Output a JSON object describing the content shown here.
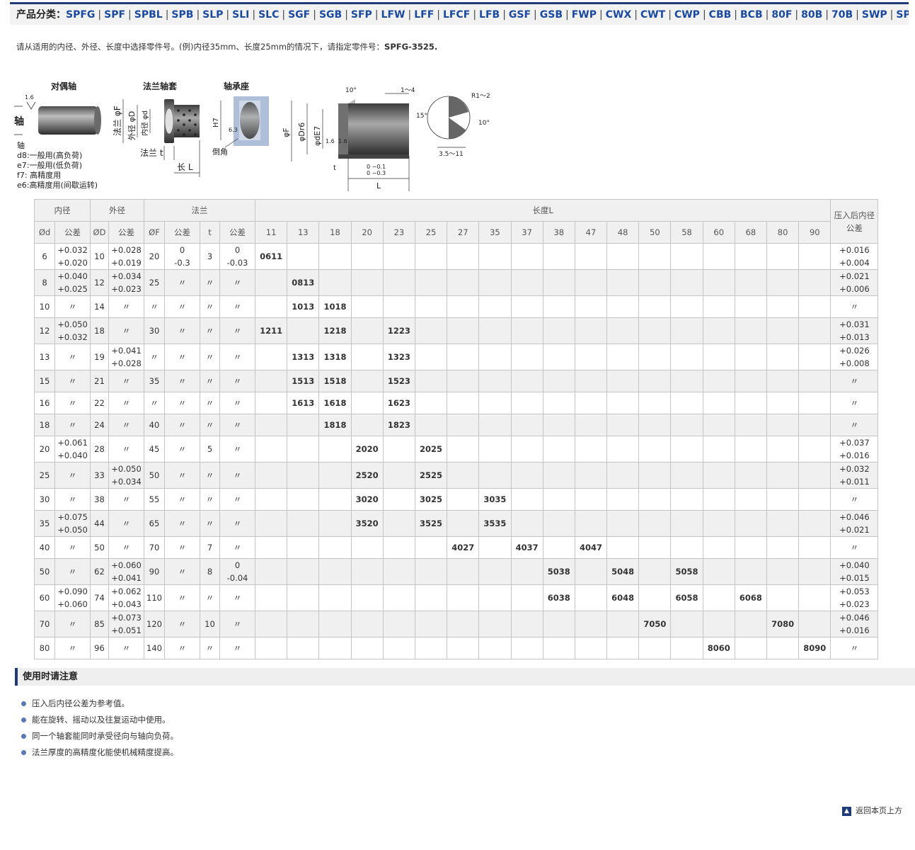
{
  "category_bar": {
    "label": "产品分类：",
    "items": [
      "SPFG",
      "SPF",
      "SPBL",
      "SPB",
      "SLP",
      "SLI",
      "SLC",
      "SGF",
      "SGB",
      "SFP",
      "LFW",
      "LFF",
      "LFCF",
      "LFB",
      "GSF",
      "GSB",
      "FWP",
      "CWX",
      "CWT",
      "CWP",
      "CBB",
      "BCB",
      "80F",
      "80B",
      "70B",
      "SWP",
      "SPW"
    ]
  },
  "intro": {
    "text": "请从适用的内径、外径、长度中选择零件号。(例)内径35mm、长度25mm的情况下，请指定零件号：",
    "example_pn": "SPFG-3525."
  },
  "diagram": {
    "labels": {
      "shaft_title": "对偶轴",
      "flange_bush_title": "法兰轴套",
      "housing_title": "轴承座",
      "roughness": "1.6",
      "shaft_word": "轴",
      "flange_dia": "法兰 φF",
      "outer_dia": "外径 φD",
      "inner_dia": "内径 φd",
      "flange_t": "法兰 t",
      "length_l": "长 L",
      "h7": "H7",
      "roughness_h": "6.3",
      "chamfer": "倒角",
      "angle_10": "10°",
      "range_1_4": "1～4",
      "angle_15": "15°",
      "phi_f": "φF",
      "phi_dr6": "φDr6",
      "phi_de7": "φdE7",
      "rough_a": "1.6",
      "rough_b": "1.6",
      "t_label": "t",
      "l_tol": "0 −0.1",
      "l_tol2": "0 −0.3",
      "l_label": "L",
      "r_label": "R1～2",
      "angle_10b": "10°",
      "range_35_11": "3.5～11"
    },
    "shaft_notes": [
      "轴",
      "d8:一般用(高负荷)",
      "e7:一般用(低负荷)",
      "f7: 高精度用",
      "e6:高精度用(间歇运转)"
    ]
  },
  "table": {
    "group_headers": {
      "inner": "内径",
      "outer": "外径",
      "flange": "法兰",
      "length": "长度L",
      "press": "压入后内径公差"
    },
    "sub_headers": {
      "d": "Ød",
      "tol1": "公差",
      "D": "ØD",
      "tol2": "公差",
      "F": "ØF",
      "tol3": "公差",
      "t": "t",
      "tol4": "公差"
    },
    "lengths": [
      "11",
      "13",
      "18",
      "20",
      "23",
      "25",
      "27",
      "35",
      "37",
      "38",
      "47",
      "48",
      "50",
      "58",
      "60",
      "68",
      "80",
      "90"
    ],
    "rows": [
      {
        "d": "6",
        "dt": [
          "+0.032",
          "+0.020"
        ],
        "D": "10",
        "Dt": [
          "+0.028",
          "+0.019"
        ],
        "F": "20",
        "Ft": [
          "0",
          "-0.3"
        ],
        "t": "3",
        "tt": [
          "0",
          "-0.03"
        ],
        "cells": {
          "11": "0611"
        },
        "pt": [
          "+0.016",
          "+0.004"
        ]
      },
      {
        "d": "8",
        "dt": [
          "+0.040",
          "+0.025"
        ],
        "D": "12",
        "Dt": [
          "+0.034",
          "+0.023"
        ],
        "F": "25",
        "Ft": [
          "〃"
        ],
        "t": "〃",
        "tt": [
          "〃"
        ],
        "cells": {
          "13": "0813"
        },
        "pt": [
          "+0.021",
          "+0.006"
        ]
      },
      {
        "d": "10",
        "dt": [
          "〃"
        ],
        "D": "14",
        "Dt": [
          "〃"
        ],
        "F": "〃",
        "Ft": [
          "〃"
        ],
        "t": "〃",
        "tt": [
          "〃"
        ],
        "cells": {
          "13": "1013",
          "18": "1018"
        },
        "pt": [
          "〃"
        ]
      },
      {
        "d": "12",
        "dt": [
          "+0.050",
          "+0.032"
        ],
        "D": "18",
        "Dt": [
          "〃"
        ],
        "F": "30",
        "Ft": [
          "〃"
        ],
        "t": "〃",
        "tt": [
          "〃"
        ],
        "cells": {
          "11": "1211",
          "18": "1218",
          "23": "1223"
        },
        "pt": [
          "+0.031",
          "+0.013"
        ]
      },
      {
        "d": "13",
        "dt": [
          "〃"
        ],
        "D": "19",
        "Dt": [
          "+0.041",
          "+0.028"
        ],
        "F": "〃",
        "Ft": [
          "〃"
        ],
        "t": "〃",
        "tt": [
          "〃"
        ],
        "cells": {
          "13": "1313",
          "18": "1318",
          "23": "1323"
        },
        "pt": [
          "+0.026",
          "+0.008"
        ]
      },
      {
        "d": "15",
        "dt": [
          "〃"
        ],
        "D": "21",
        "Dt": [
          "〃"
        ],
        "F": "35",
        "Ft": [
          "〃"
        ],
        "t": "〃",
        "tt": [
          "〃"
        ],
        "cells": {
          "13": "1513",
          "18": "1518",
          "23": "1523"
        },
        "pt": [
          "〃"
        ]
      },
      {
        "d": "16",
        "dt": [
          "〃"
        ],
        "D": "22",
        "Dt": [
          "〃"
        ],
        "F": "〃",
        "Ft": [
          "〃"
        ],
        "t": "〃",
        "tt": [
          "〃"
        ],
        "cells": {
          "13": "1613",
          "18": "1618",
          "23": "1623"
        },
        "pt": [
          "〃"
        ]
      },
      {
        "d": "18",
        "dt": [
          "〃"
        ],
        "D": "24",
        "Dt": [
          "〃"
        ],
        "F": "40",
        "Ft": [
          "〃"
        ],
        "t": "〃",
        "tt": [
          "〃"
        ],
        "cells": {
          "18": "1818",
          "23": "1823"
        },
        "pt": [
          "〃"
        ]
      },
      {
        "d": "20",
        "dt": [
          "+0.061",
          "+0.040"
        ],
        "D": "28",
        "Dt": [
          "〃"
        ],
        "F": "45",
        "Ft": [
          "〃"
        ],
        "t": "5",
        "tt": [
          "〃"
        ],
        "cells": {
          "20": "2020",
          "25": "2025"
        },
        "pt": [
          "+0.037",
          "+0.016"
        ]
      },
      {
        "d": "25",
        "dt": [
          "〃"
        ],
        "D": "33",
        "Dt": [
          "+0.050",
          "+0.034"
        ],
        "F": "50",
        "Ft": [
          "〃"
        ],
        "t": "〃",
        "tt": [
          "〃"
        ],
        "cells": {
          "20": "2520",
          "25": "2525"
        },
        "pt": [
          "+0.032",
          "+0.011"
        ]
      },
      {
        "d": "30",
        "dt": [
          "〃"
        ],
        "D": "38",
        "Dt": [
          "〃"
        ],
        "F": "55",
        "Ft": [
          "〃"
        ],
        "t": "〃",
        "tt": [
          "〃"
        ],
        "cells": {
          "20": "3020",
          "25": "3025",
          "35": "3035"
        },
        "pt": [
          "〃"
        ]
      },
      {
        "d": "35",
        "dt": [
          "+0.075",
          "+0.050"
        ],
        "D": "44",
        "Dt": [
          "〃"
        ],
        "F": "65",
        "Ft": [
          "〃"
        ],
        "t": "〃",
        "tt": [
          "〃"
        ],
        "cells": {
          "20": "3520",
          "25": "3525",
          "35": "3535"
        },
        "pt": [
          "+0.046",
          "+0.021"
        ]
      },
      {
        "d": "40",
        "dt": [
          "〃"
        ],
        "D": "50",
        "Dt": [
          "〃"
        ],
        "F": "70",
        "Ft": [
          "〃"
        ],
        "t": "7",
        "tt": [
          "〃"
        ],
        "cells": {
          "27": "4027",
          "37": "4037",
          "47": "4047"
        },
        "pt": [
          "〃"
        ]
      },
      {
        "d": "50",
        "dt": [
          "〃"
        ],
        "D": "62",
        "Dt": [
          "+0.060",
          "+0.041"
        ],
        "F": "90",
        "Ft": [
          "〃"
        ],
        "t": "8",
        "tt": [
          "0",
          "-0.04"
        ],
        "cells": {
          "38": "5038",
          "48": "5048",
          "58": "5058"
        },
        "pt": [
          "+0.040",
          "+0.015"
        ]
      },
      {
        "d": "60",
        "dt": [
          "+0.090",
          "+0.060"
        ],
        "D": "74",
        "Dt": [
          "+0.062",
          "+0.043"
        ],
        "F": "110",
        "Ft": [
          "〃"
        ],
        "t": "〃",
        "tt": [
          "〃"
        ],
        "cells": {
          "38": "6038",
          "48": "6048",
          "58": "6058",
          "68": "6068"
        },
        "pt": [
          "+0.053",
          "+0.023"
        ]
      },
      {
        "d": "70",
        "dt": [
          "〃"
        ],
        "D": "85",
        "Dt": [
          "+0.073",
          "+0.051"
        ],
        "F": "120",
        "Ft": [
          "〃"
        ],
        "t": "10",
        "tt": [
          "〃"
        ],
        "cells": {
          "50": "7050",
          "80": "7080"
        },
        "pt": [
          "+0.046",
          "+0.016"
        ]
      },
      {
        "d": "80",
        "dt": [
          "〃"
        ],
        "D": "96",
        "Dt": [
          "〃"
        ],
        "F": "140",
        "Ft": [
          "〃"
        ],
        "t": "〃",
        "tt": [
          "〃"
        ],
        "cells": {
          "60": "8060",
          "90": "8090"
        },
        "pt": [
          "〃"
        ]
      }
    ]
  },
  "notice": {
    "title": "使用时请注意",
    "items": [
      "压入后内径公差为参考值。",
      "能在旋转、摇动以及往复运动中使用。",
      "同一个轴套能同时承受径向与轴向负荷。",
      "法兰厚度的高精度化能使机械精度提高。"
    ]
  },
  "back_to_top": "返回本页上方"
}
